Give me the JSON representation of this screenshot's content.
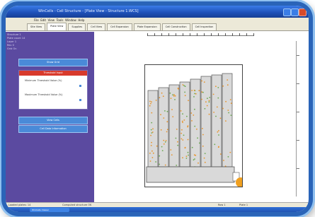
{
  "window": {
    "title": "WinCells - Cell Structure - [Plate View - Structure 1.WCS]"
  },
  "menu": {
    "items": [
      "File",
      "Edit",
      "View",
      "Tools",
      "Window",
      "Help"
    ]
  },
  "tabs": [
    {
      "label": "Site View"
    },
    {
      "label": "Plate View"
    },
    {
      "label": "Supplies"
    },
    {
      "label": "Cell View"
    },
    {
      "label": "Cell Expansion"
    },
    {
      "label": "Plate Expansion"
    },
    {
      "label": "Cell Construction"
    },
    {
      "label": "Cell Inspection"
    }
  ],
  "sidebar": {
    "info_lines": [
      "Structure 1",
      "Plate count 14",
      "Layer 1",
      "Rev 0",
      "Grid On"
    ],
    "show_grid_label": "Show Grid",
    "threshold_header": "Threshold Input",
    "minimum_label": "Minimum Threshold Value (%)",
    "maximum_label": "Maximum Threshold Value (%)",
    "view_cells_label": "View Cells",
    "cell_data_label": "Cell Data Information"
  },
  "status": {
    "left": "Loaded plates: 14",
    "middle": "Computed structure OK",
    "right_1": "Row 1",
    "right_2": "Plate 1"
  },
  "taskbar": {
    "active_task": "WinCells Viewer"
  },
  "colors": {
    "sidebar": "#5b4aa0",
    "accent_button": "#4a8ad8",
    "threshold_header": "#d83a2c",
    "dot_orange": "#e8932a",
    "dot_green": "#6aa84f",
    "plate_fill": "#d9d9d9",
    "handle": "#f0a020"
  },
  "icons": {
    "close": "close-icon",
    "maximize": "maximize-icon",
    "minimize": "minimize-icon",
    "handle": "resize-handle-icon"
  }
}
